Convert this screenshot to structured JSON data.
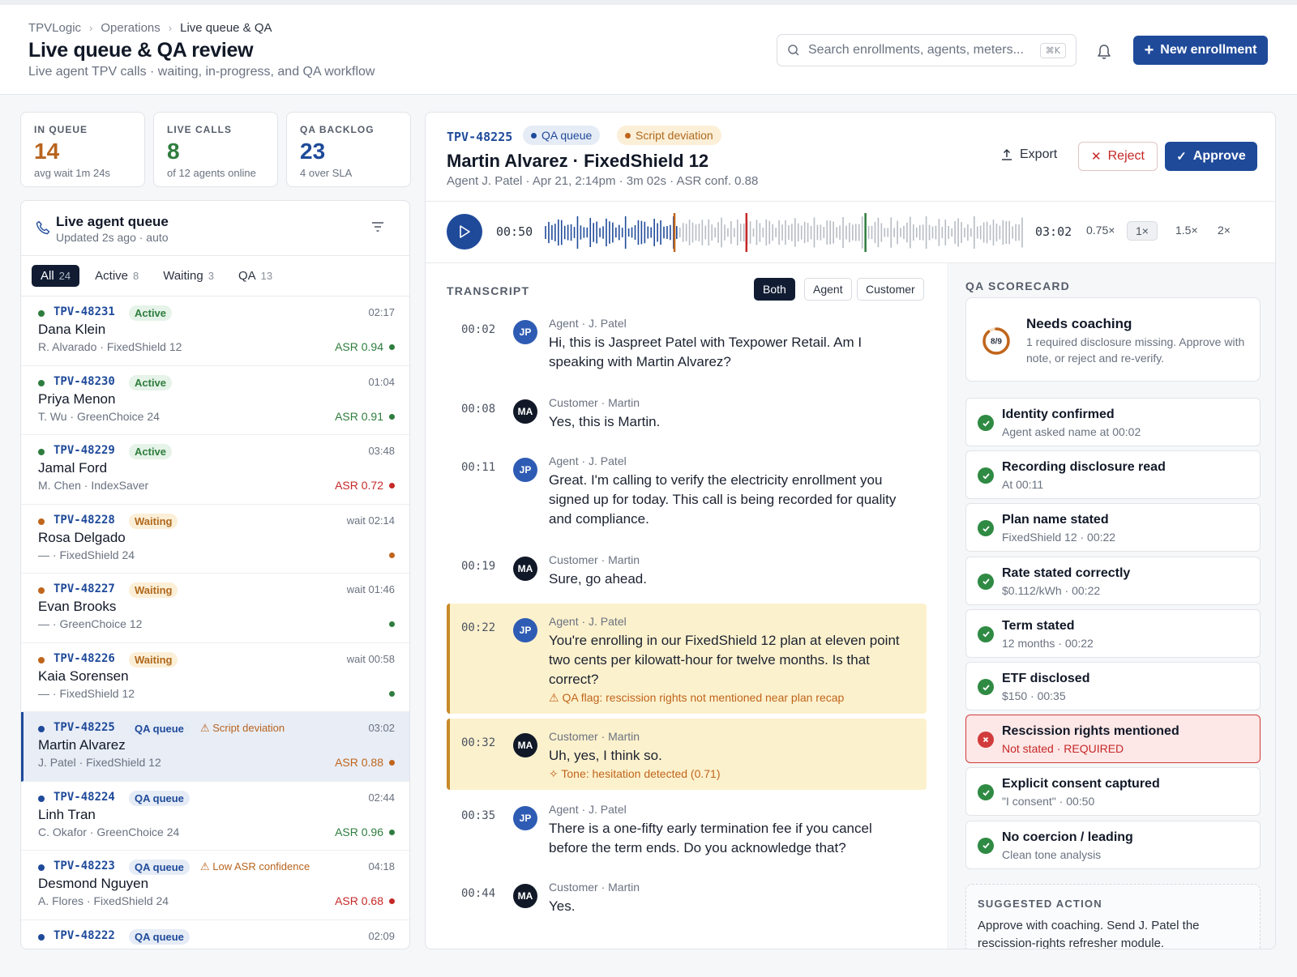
{
  "breadcrumb": {
    "root": "TPVLogic",
    "section": "Operations",
    "current": "Live queue & QA"
  },
  "page": {
    "title": "Live queue & QA review",
    "subtitle": "Live agent TPV calls · waiting, in-progress, and QA workflow"
  },
  "search": {
    "placeholder": "Search enrollments, agents, meters...",
    "shortcut": "⌘K"
  },
  "new_button": "New enrollment",
  "stats": [
    {
      "label": "IN QUEUE",
      "value": "14",
      "sub": "avg wait 1m 24s",
      "color": "#b8641e"
    },
    {
      "label": "LIVE CALLS",
      "value": "8",
      "sub": "of 12 agents online",
      "color": "#2f7d3e"
    },
    {
      "label": "QA BACKLOG",
      "value": "23",
      "sub": "4 over SLA",
      "color": "#1f4a9a"
    }
  ],
  "queue": {
    "title": "Live agent queue",
    "updated": "Updated 2s ago · auto",
    "tabs": [
      {
        "label": "All",
        "count": "24"
      },
      {
        "label": "Active",
        "count": "8"
      },
      {
        "label": "Waiting",
        "count": "3"
      },
      {
        "label": "QA",
        "count": "13"
      }
    ],
    "rows": [
      {
        "id": "TPV-48231",
        "status": "Active",
        "time": "02:17",
        "name": "Dana Klein",
        "meta": "R. Alvarado · FixedShield 12",
        "asr": "ASR 0.94",
        "asr_color": "#2f7d3e"
      },
      {
        "id": "TPV-48230",
        "status": "Active",
        "time": "01:04",
        "name": "Priya Menon",
        "meta": "T. Wu · GreenChoice 24",
        "asr": "ASR 0.91",
        "asr_color": "#2f7d3e"
      },
      {
        "id": "TPV-48229",
        "status": "Active",
        "time": "03:48",
        "name": "Jamal Ford",
        "meta": "M. Chen · IndexSaver",
        "asr": "ASR 0.72",
        "asr_color": "#c62828"
      },
      {
        "id": "TPV-48228",
        "status": "Waiting",
        "time": "wait 02:14",
        "name": "Rosa Delgado",
        "meta": "— · FixedShield 24",
        "asr": "",
        "asr_color": "#c0651c"
      },
      {
        "id": "TPV-48227",
        "status": "Waiting",
        "time": "wait 01:46",
        "name": "Evan Brooks",
        "meta": "— · GreenChoice 12",
        "asr": "",
        "asr_color": "#2f7d3e"
      },
      {
        "id": "TPV-48226",
        "status": "Waiting",
        "time": "wait 00:58",
        "name": "Kaia Sorensen",
        "meta": "— · FixedShield 12",
        "asr": "",
        "asr_color": "#2f7d3e"
      },
      {
        "id": "TPV-48225",
        "status": "QA queue",
        "flag": "⚠ Script deviation",
        "time": "03:02",
        "name": "Martin Alvarez",
        "meta": "J. Patel · FixedShield 12",
        "asr": "ASR 0.88",
        "asr_color": "#c0651c",
        "selected": true
      },
      {
        "id": "TPV-48224",
        "status": "QA queue",
        "time": "02:44",
        "name": "Linh Tran",
        "meta": "C. Okafor · GreenChoice 24",
        "asr": "ASR 0.96",
        "asr_color": "#2f7d3e"
      },
      {
        "id": "TPV-48223",
        "status": "QA queue",
        "flag": "⚠ Low ASR confidence",
        "time": "04:18",
        "name": "Desmond Nguyen",
        "meta": "A. Flores · FixedShield 24",
        "asr": "ASR 0.68",
        "asr_color": "#c62828"
      },
      {
        "id": "TPV-48222",
        "status": "QA queue",
        "time": "02:09",
        "name": "",
        "meta": "",
        "asr": "",
        "asr_color": ""
      }
    ]
  },
  "detail": {
    "id": "TPV-48225",
    "pill_qa": "QA queue",
    "pill_dev": "Script deviation",
    "title": "Martin Alvarez · FixedShield 12",
    "meta": "Agent J. Patel · Apr 21, 2:14pm · 3m 02s · ASR conf. 0.88",
    "export": "Export",
    "reject": "Reject",
    "approve": "Approve"
  },
  "player": {
    "current": "00:50",
    "total": "03:02",
    "progress": 0.275,
    "markers": [
      0.272,
      0.422,
      0.67
    ],
    "speeds": [
      "0.75×",
      "1×",
      "1.5×",
      "2×"
    ],
    "active_speed": "1×"
  },
  "transcript": {
    "label": "TRANSCRIPT",
    "filters": [
      "Both",
      "Agent",
      "Customer"
    ],
    "entries": [
      {
        "ts": "00:02",
        "who": "JP",
        "speaker": "Agent · J. Patel",
        "text": "Hi, this is Jaspreet Patel with Texpower Retail. Am I speaking with Martin Alvarez?"
      },
      {
        "ts": "00:08",
        "who": "MA",
        "speaker": "Customer · Martin",
        "text": "Yes, this is Martin."
      },
      {
        "ts": "00:11",
        "who": "JP",
        "speaker": "Agent · J. Patel",
        "text": "Great. I'm calling to verify the electricity enrollment you signed up for today. This call is being recorded for quality and compliance."
      },
      {
        "ts": "00:19",
        "who": "MA",
        "speaker": "Customer · Martin",
        "text": "Sure, go ahead."
      },
      {
        "ts": "00:22",
        "who": "JP",
        "speaker": "Agent · J. Patel",
        "text": "You're enrolling in our FixedShield 12 plan at eleven point two cents per kilowatt-hour for twelve months. Is that correct?",
        "note": "⚠ QA flag: rescission rights not mentioned near plan recap"
      },
      {
        "ts": "00:32",
        "who": "MA",
        "speaker": "Customer · Martin",
        "text": "Uh, yes, I think so.",
        "note": "✧ Tone: hesitation detected (0.71)"
      },
      {
        "ts": "00:35",
        "who": "JP",
        "speaker": "Agent · J. Patel",
        "text": "There is a one-fifty early termination fee if you cancel before the term ends. Do you acknowledge that?"
      },
      {
        "ts": "00:44",
        "who": "MA",
        "speaker": "Customer · Martin",
        "text": "Yes."
      }
    ]
  },
  "scorecard": {
    "label": "QA SCORECARD",
    "score": "8/9",
    "score_fraction": 0.889,
    "verdict": "Needs coaching",
    "verdict_desc": "1 required disclosure missing. Approve with note, or reject and re-verify.",
    "checks": [
      {
        "title": "Identity confirmed",
        "sub": "Agent asked name at 00:02",
        "ok": true
      },
      {
        "title": "Recording disclosure read",
        "sub": "At 00:11",
        "ok": true
      },
      {
        "title": "Plan name stated",
        "sub": "FixedShield 12 · 00:22",
        "ok": true
      },
      {
        "title": "Rate stated correctly",
        "sub": "$0.112/kWh · 00:22",
        "ok": true
      },
      {
        "title": "Term stated",
        "sub": "12 months · 00:22",
        "ok": true
      },
      {
        "title": "ETF disclosed",
        "sub": "$150 · 00:35",
        "ok": true
      },
      {
        "title": "Rescission rights mentioned",
        "sub": "Not stated · REQUIRED",
        "ok": false
      },
      {
        "title": "Explicit consent captured",
        "sub": "\"I consent\" · 00:50",
        "ok": true
      },
      {
        "title": "No coercion / leading",
        "sub": "Clean tone analysis",
        "ok": true
      }
    ],
    "suggested_label": "SUGGESTED ACTION",
    "suggested_text": "Approve with coaching. Send J. Patel the rescission-rights refresher module."
  }
}
